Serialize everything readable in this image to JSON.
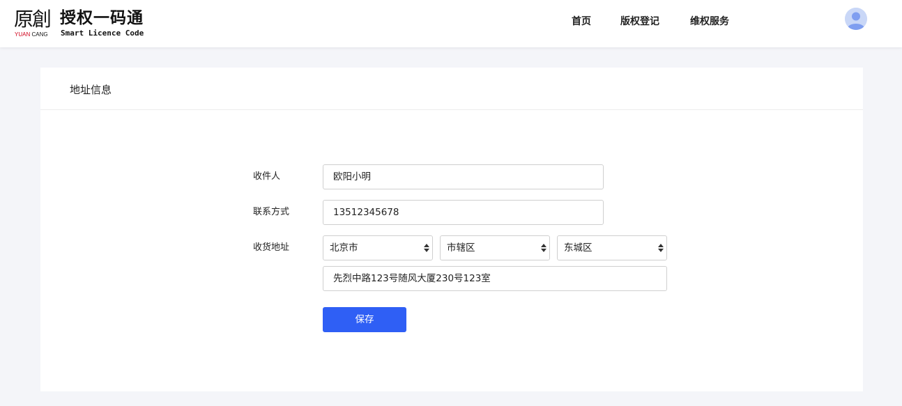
{
  "header": {
    "logo": {
      "glyphs": "原創",
      "sub_red": "YUAN",
      "sub_dark": "CANG",
      "title": "授权一码通",
      "slogan": "Smart Licence Code"
    },
    "nav": {
      "home": "首页",
      "register": "版权登记",
      "service": "维权服务"
    },
    "avatar_icon": "user-avatar-icon"
  },
  "card": {
    "title": "地址信息",
    "form": {
      "recipient_label": "收件人",
      "recipient_value": "欧阳小明",
      "phone_label": "联系方式",
      "phone_value": "13512345678",
      "address_label": "收货地址",
      "province": "北京市",
      "city": "市辖区",
      "district": "东城区",
      "detail_address": "先烈中路123号随风大厦230号123室",
      "save_label": "保存"
    }
  },
  "colors": {
    "accent": "#2f5ff5",
    "background": "#f4f5f9",
    "logo_red": "#d0021b"
  }
}
